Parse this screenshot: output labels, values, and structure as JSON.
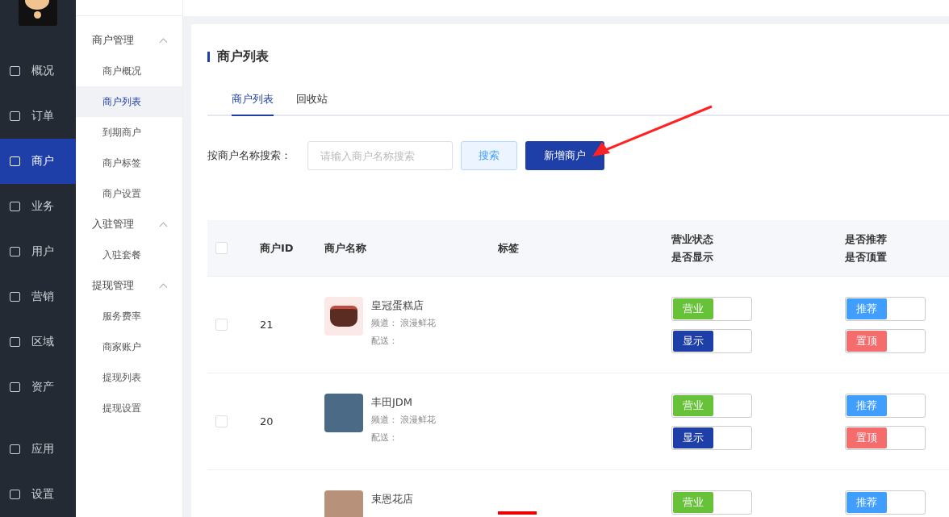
{
  "nav": [
    {
      "label": "概况",
      "selected": false
    },
    {
      "label": "订单",
      "selected": false
    },
    {
      "label": "商户",
      "selected": true
    },
    {
      "label": "业务",
      "selected": false
    },
    {
      "label": "用户",
      "selected": false
    },
    {
      "label": "营销",
      "selected": false
    },
    {
      "label": "区域",
      "selected": false
    },
    {
      "label": "资产",
      "selected": false
    }
  ],
  "nav_bottom": [
    {
      "label": "应用",
      "selected": false
    },
    {
      "label": "设置",
      "selected": false
    }
  ],
  "submenu": [
    {
      "label": "商户管理",
      "expanded": true,
      "children": [
        {
          "label": "商户概况",
          "selected": false
        },
        {
          "label": "商户列表",
          "selected": true
        },
        {
          "label": "到期商户",
          "selected": false
        },
        {
          "label": "商户标签",
          "selected": false
        },
        {
          "label": "商户设置",
          "selected": false
        }
      ]
    },
    {
      "label": "入驻管理",
      "expanded": true,
      "children": [
        {
          "label": "入驻套餐",
          "selected": false
        }
      ]
    },
    {
      "label": "提现管理",
      "expanded": true,
      "children": [
        {
          "label": "服务费率",
          "selected": false
        },
        {
          "label": "商家账户",
          "selected": false
        },
        {
          "label": "提现列表",
          "selected": false
        },
        {
          "label": "提现设置",
          "selected": false
        }
      ]
    }
  ],
  "page_title": "商户列表",
  "tabs": [
    {
      "label": "商户列表",
      "selected": true
    },
    {
      "label": "回收站",
      "selected": false
    }
  ],
  "search": {
    "label": "按商户名称搜索：",
    "placeholder": "请输入商户名称搜索",
    "button": "搜索",
    "add_button": "新增商户"
  },
  "table": {
    "all_checked": false,
    "columns": [
      {
        "lines": [
          "商户ID"
        ]
      },
      {
        "lines": [
          "商户名称"
        ]
      },
      {
        "lines": [
          "标签"
        ]
      },
      {
        "lines": [
          "营业状态",
          "是否显示"
        ]
      },
      {
        "lines": [
          "是否推荐",
          "是否顶置"
        ]
      }
    ],
    "rows": [
      {
        "checked": false,
        "id": "21",
        "name": "皇冠蛋糕店",
        "channel": "频道： 浪漫鲜花",
        "delivery": "配送：",
        "tag_mark": false,
        "status": [
          {
            "label": "营业",
            "on": true,
            "color": "#67c23a"
          },
          {
            "label": "显示",
            "on": true,
            "color": "#1e3fa8"
          }
        ],
        "flags": [
          {
            "label": "推荐",
            "on": true,
            "color": "#409eff"
          },
          {
            "label": "置顶",
            "on": true,
            "color": "#f56c6c"
          }
        ]
      },
      {
        "checked": false,
        "id": "20",
        "name": "丰田JDM",
        "channel": "频道： 浪漫鲜花",
        "delivery": "配送：",
        "tag_mark": false,
        "status": [
          {
            "label": "营业",
            "on": true,
            "color": "#67c23a"
          },
          {
            "label": "显示",
            "on": true,
            "color": "#1e3fa8"
          }
        ],
        "flags": [
          {
            "label": "推荐",
            "on": true,
            "color": "#409eff"
          },
          {
            "label": "置顶",
            "on": true,
            "color": "#f56c6c"
          }
        ]
      },
      {
        "name": "束恩花店",
        "tag_mark": true,
        "status": [
          {
            "label": "营业",
            "on": true,
            "color": "#67c23a"
          }
        ],
        "flags": [
          {
            "label": "推荐",
            "on": true,
            "color": "#409eff"
          }
        ]
      }
    ]
  },
  "annotation_arrow": true
}
